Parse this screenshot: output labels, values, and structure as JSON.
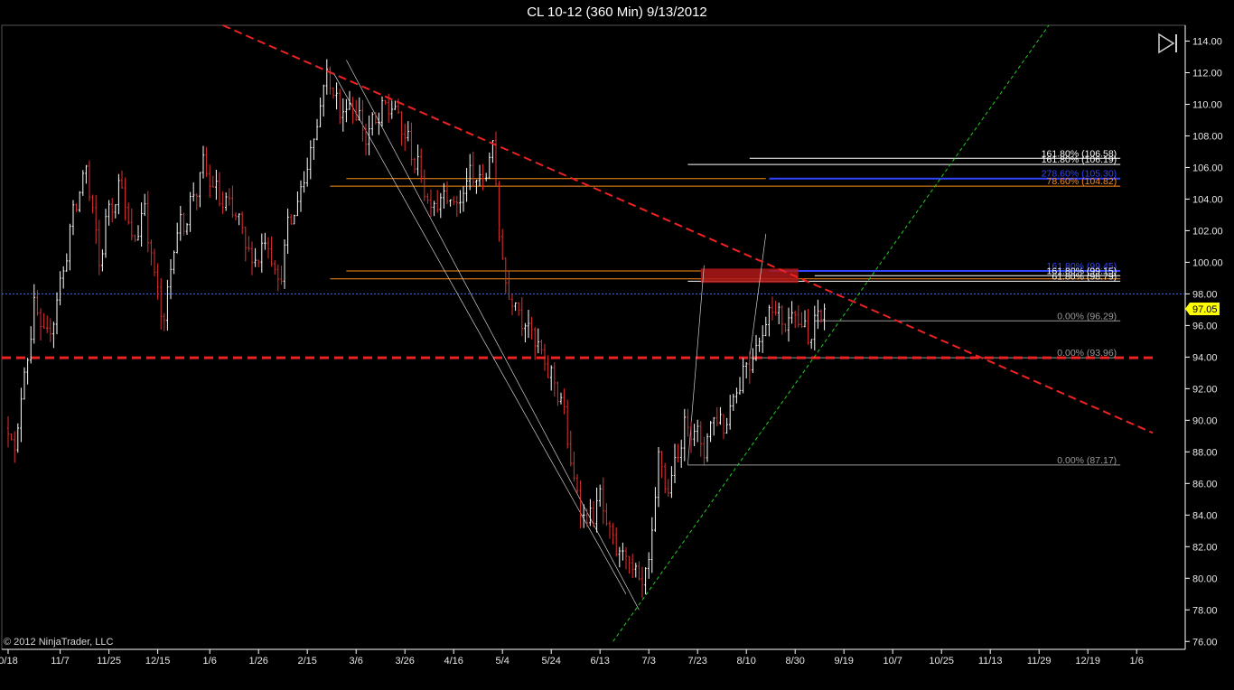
{
  "title": "CL 10-12 (360 Min)  9/13/2012",
  "copyright": "© 2012 NinjaTrader, LLC",
  "colors": {
    "background": "#000000",
    "axis": "#ffffff",
    "bar_up": "#ffffff",
    "bar_down": "#e03030",
    "trend_down": "#ee2222",
    "support": "#ee2222",
    "trend_up": "#22cc22",
    "fib_white": "#ffffff",
    "fib_orange": "#ff8c1a",
    "fib_blue": "#3344ff",
    "fib_gray": "#9a9a9a",
    "current_line": "#4466ff",
    "price_marker": "#ffff00"
  },
  "chart_data": {
    "type": "line",
    "title": "CL 10-12 (360 Min)  9/13/2012",
    "ylim": [
      75.5,
      115
    ],
    "grid": false,
    "y_ticks": [
      76.0,
      78.0,
      80.0,
      82.0,
      84.0,
      86.0,
      88.0,
      90.0,
      92.0,
      94.0,
      96.0,
      98.0,
      100.0,
      102.0,
      104.0,
      106.0,
      108.0,
      110.0,
      112.0,
      114.0
    ],
    "x_ticks": [
      {
        "label": "0/18",
        "i": 0
      },
      {
        "label": "11/7",
        "i": 16
      },
      {
        "label": "11/25",
        "i": 31
      },
      {
        "label": "12/15",
        "i": 46
      },
      {
        "label": "1/6",
        "i": 62
      },
      {
        "label": "1/26",
        "i": 77
      },
      {
        "label": "2/15",
        "i": 92
      },
      {
        "label": "3/6",
        "i": 107
      },
      {
        "label": "3/26",
        "i": 122
      },
      {
        "label": "4/16",
        "i": 137
      },
      {
        "label": "5/4",
        "i": 152
      },
      {
        "label": "5/24",
        "i": 167
      },
      {
        "label": "6/13",
        "i": 182
      },
      {
        "label": "7/3",
        "i": 197
      },
      {
        "label": "7/23",
        "i": 212
      },
      {
        "label": "8/10",
        "i": 227
      },
      {
        "label": "8/30",
        "i": 242
      },
      {
        "label": "9/19",
        "i": 257
      },
      {
        "label": "10/7",
        "i": 272
      },
      {
        "label": "10/25",
        "i": 287
      },
      {
        "label": "11/13",
        "i": 302
      },
      {
        "label": "11/29",
        "i": 317
      },
      {
        "label": "12/19",
        "i": 332
      },
      {
        "label": "1/6",
        "i": 347
      }
    ],
    "last_price": 97.05,
    "current_line_value": 98.0,
    "price_keypoints": [
      [
        0,
        89.5
      ],
      [
        2,
        88.0
      ],
      [
        5,
        93.0
      ],
      [
        8,
        97.0
      ],
      [
        12,
        95.0
      ],
      [
        16,
        98.5
      ],
      [
        20,
        103.0
      ],
      [
        24,
        106.0
      ],
      [
        28,
        100.0
      ],
      [
        31,
        103.5
      ],
      [
        35,
        105.0
      ],
      [
        38,
        101.0
      ],
      [
        42,
        103.5
      ],
      [
        45,
        99.0
      ],
      [
        48,
        96.0
      ],
      [
        51,
        101.5
      ],
      [
        55,
        103.0
      ],
      [
        60,
        106.0
      ],
      [
        65,
        104.0
      ],
      [
        70,
        103.0
      ],
      [
        75,
        100.0
      ],
      [
        80,
        101.5
      ],
      [
        83,
        98.5
      ],
      [
        86,
        102.0
      ],
      [
        90,
        104.5
      ],
      [
        94,
        108.0
      ],
      [
        98,
        112.0
      ],
      [
        102,
        109.5
      ],
      [
        106,
        110.0
      ],
      [
        110,
        108.0
      ],
      [
        115,
        109.5
      ],
      [
        118,
        110.0
      ],
      [
        122,
        108.0
      ],
      [
        126,
        106.0
      ],
      [
        130,
        103.5
      ],
      [
        134,
        104.5
      ],
      [
        138,
        103.5
      ],
      [
        142,
        105.5
      ],
      [
        146,
        105.0
      ],
      [
        149,
        107.5
      ],
      [
        151,
        102.0
      ],
      [
        153,
        98.5
      ],
      [
        157,
        97.0
      ],
      [
        161,
        95.5
      ],
      [
        165,
        93.5
      ],
      [
        170,
        91.5
      ],
      [
        174,
        86.0
      ],
      [
        178,
        83.5
      ],
      [
        182,
        85.0
      ],
      [
        186,
        82.0
      ],
      [
        190,
        81.5
      ],
      [
        194,
        79.5
      ],
      [
        197,
        80.5
      ],
      [
        200,
        87.5
      ],
      [
        203,
        85.5
      ],
      [
        206,
        88.0
      ],
      [
        209,
        90.0
      ],
      [
        212,
        89.0
      ],
      [
        214,
        88.0
      ],
      [
        217,
        90.5
      ],
      [
        220,
        89.5
      ],
      [
        223,
        91.5
      ],
      [
        227,
        93.5
      ],
      [
        231,
        95.0
      ],
      [
        235,
        97.5
      ],
      [
        238,
        96.0
      ],
      [
        242,
        97.0
      ],
      [
        246,
        95.0
      ],
      [
        249,
        96.5
      ],
      [
        251,
        97.05
      ]
    ],
    "trendlines": [
      {
        "name": "down-trend",
        "p1": [
          66,
          115.0
        ],
        "p2": [
          352,
          89.2
        ],
        "style": "dashed",
        "color": "trend_down",
        "width": 2
      },
      {
        "name": "up-trend",
        "p1": [
          186,
          76.0
        ],
        "p2": [
          320,
          115.0
        ],
        "style": "dashed",
        "color": "trend_up",
        "width": 1
      }
    ],
    "hlines": [
      {
        "name": "support-94",
        "value": 93.96,
        "x0": 0,
        "x1": 352,
        "style": "dashed",
        "color": "support",
        "width": 3
      }
    ],
    "fib_lines": [
      {
        "value": 106.58,
        "x0": 228,
        "x1": 342,
        "color": "fib_white",
        "label": "161.80% (106.58)"
      },
      {
        "value": 106.19,
        "x0": 209,
        "x1": 342,
        "color": "fib_white",
        "label": "161.80% (106.19)"
      },
      {
        "value": 105.3,
        "x0": 104,
        "x1": 233,
        "color": "fib_orange",
        "label": ""
      },
      {
        "value": 105.3,
        "x0": 234,
        "x1": 342,
        "color": "fib_blue",
        "label": "278.60% (105.30)"
      },
      {
        "value": 104.82,
        "x0": 99,
        "x1": 342,
        "color": "fib_orange",
        "label": "78.60% (104.82)"
      },
      {
        "value": 99.45,
        "x0": 104,
        "x1": 213,
        "color": "fib_orange",
        "label": ""
      },
      {
        "value": 99.45,
        "x0": 234,
        "x1": 342,
        "color": "fib_blue",
        "label": "161.80% (99.45)"
      },
      {
        "value": 99.15,
        "x0": 248,
        "x1": 342,
        "color": "fib_white",
        "label": "161.80% (99.15)"
      },
      {
        "value": 98.95,
        "x0": 99,
        "x1": 342,
        "color": "fib_orange",
        "label": ""
      },
      {
        "value": 98.8,
        "x0": 209,
        "x1": 342,
        "color": "fib_white",
        "label": "61.80% (98.79)"
      },
      {
        "value": 96.29,
        "x0": 248,
        "x1": 342,
        "color": "fib_gray",
        "label": "0.00% (96.29)"
      },
      {
        "value": 93.96,
        "x0": 228,
        "x1": 342,
        "color": "fib_gray",
        "label": "0.00% (93.96)"
      },
      {
        "value": 87.17,
        "x0": 209,
        "x1": 342,
        "color": "fib_gray",
        "label": "0.00% (87.17)"
      }
    ],
    "zone": {
      "x0": 213,
      "x1": 243,
      "y_low": 98.7,
      "y_high": 99.6,
      "color": "#b01818"
    },
    "swing_lines": [
      {
        "p1": [
          104,
          112.8
        ],
        "p2": [
          194,
          78.0
        ]
      },
      {
        "p1": [
          100,
          112.0
        ],
        "p2": [
          190,
          79.0
        ]
      },
      {
        "p1": [
          209,
          87.17
        ],
        "p2": [
          214,
          99.8
        ]
      },
      {
        "p1": [
          228,
          93.96
        ],
        "p2": [
          233,
          101.8
        ]
      }
    ]
  }
}
